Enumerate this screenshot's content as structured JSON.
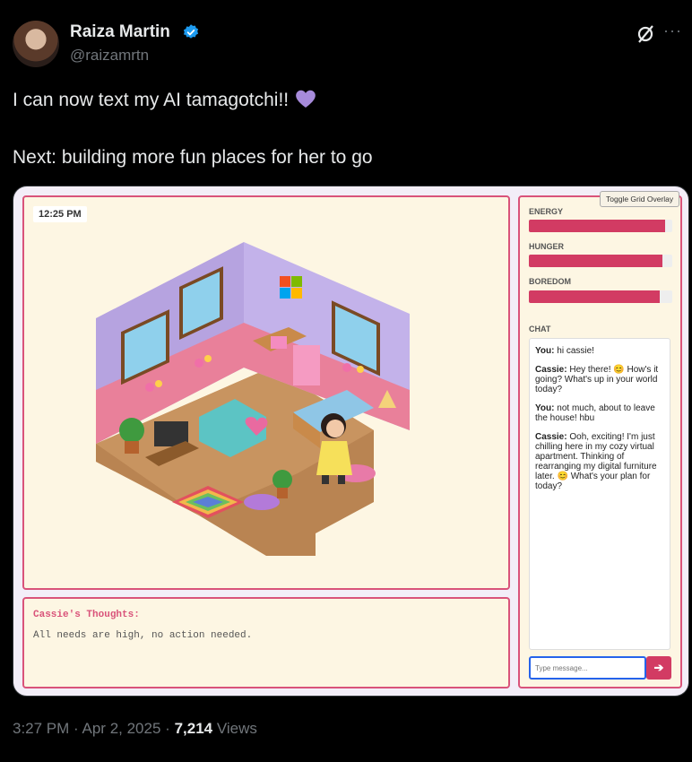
{
  "author": {
    "name": "Raiza Martin",
    "handle": "@raizamrtn"
  },
  "tweet": {
    "line1": "I can now text my AI tamagotchi!!",
    "line2": "Next: building more fun places for her to go"
  },
  "app": {
    "time": "12:25 PM",
    "toggle_label": "Toggle Grid Overlay",
    "stats": [
      {
        "label": "ENERGY",
        "level": 0.95
      },
      {
        "label": "HUNGER",
        "level": 0.93
      },
      {
        "label": "BOREDOM",
        "level": 0.91
      }
    ],
    "chat_label": "CHAT",
    "messages": [
      {
        "speaker": "You:",
        "text": "hi cassie!"
      },
      {
        "speaker": "Cassie:",
        "text": "Hey there! 😊 How's it going? What's up in your world today?"
      },
      {
        "speaker": "You:",
        "text": "not much, about to leave the house! hbu"
      },
      {
        "speaker": "Cassie:",
        "text": "Ooh, exciting! I'm just chilling here in my cozy virtual apartment. Thinking of rearranging my digital furniture later. 😊 What's your plan for today?"
      }
    ],
    "input_placeholder": "Type message...",
    "send_label": "➔",
    "thoughts_title": "Cassie's Thoughts:",
    "thoughts_text": "All needs are high, no action needed.",
    "colors": {
      "accent": "#d23b63",
      "panel": "#fdf6e3"
    }
  },
  "meta": {
    "time": "3:27 PM",
    "sep1": "·",
    "date": "Apr 2, 2025",
    "sep2": "·",
    "views": "7,214",
    "views_label": "Views"
  }
}
